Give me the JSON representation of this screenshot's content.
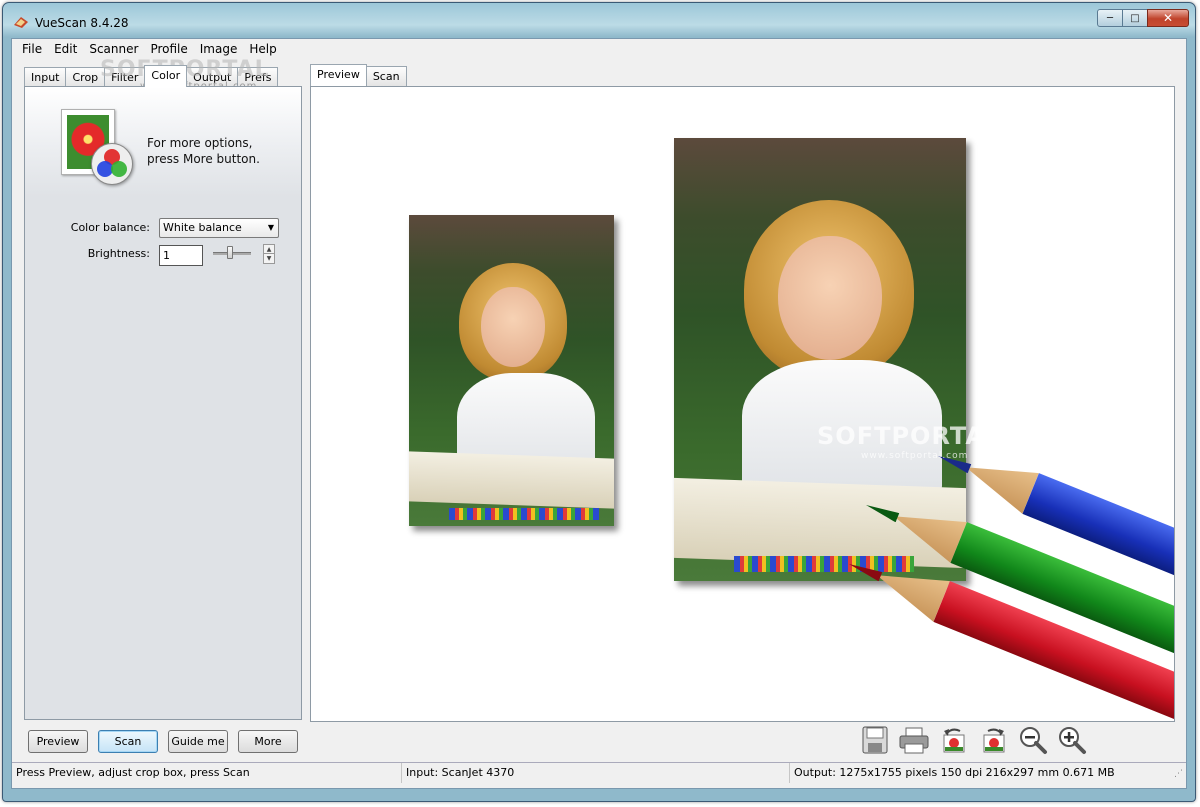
{
  "window": {
    "title": "VueScan 8.4.28"
  },
  "menu": [
    "File",
    "Edit",
    "Scanner",
    "Profile",
    "Image",
    "Help"
  ],
  "left_tabs": [
    "Input",
    "Crop",
    "Filter",
    "Color",
    "Output",
    "Prefs"
  ],
  "left_active_tab": "Color",
  "hint": {
    "text": "For more options,\npress More button."
  },
  "color": {
    "balance_label": "Color balance:",
    "balance_value": "White balance",
    "brightness_label": "Brightness:",
    "brightness_value": "1"
  },
  "right_tabs": [
    "Preview",
    "Scan"
  ],
  "right_active_tab": "Preview",
  "watermark": {
    "brand": "SOFTPORTAL",
    "url": "www.softportal.com"
  },
  "buttons": {
    "preview": "Preview",
    "scan": "Scan",
    "guide": "Guide me",
    "more": "More"
  },
  "toolbar_icons": [
    "save-icon",
    "print-icon",
    "rotate-left-icon",
    "rotate-right-icon",
    "zoom-out-icon",
    "zoom-in-icon"
  ],
  "status": {
    "left": "Press Preview, adjust crop box, press Scan",
    "middle": "Input: ScanJet 4370",
    "right": "Output: 1275x1755 pixels 150 dpi 216x297 mm 0.671 MB"
  }
}
